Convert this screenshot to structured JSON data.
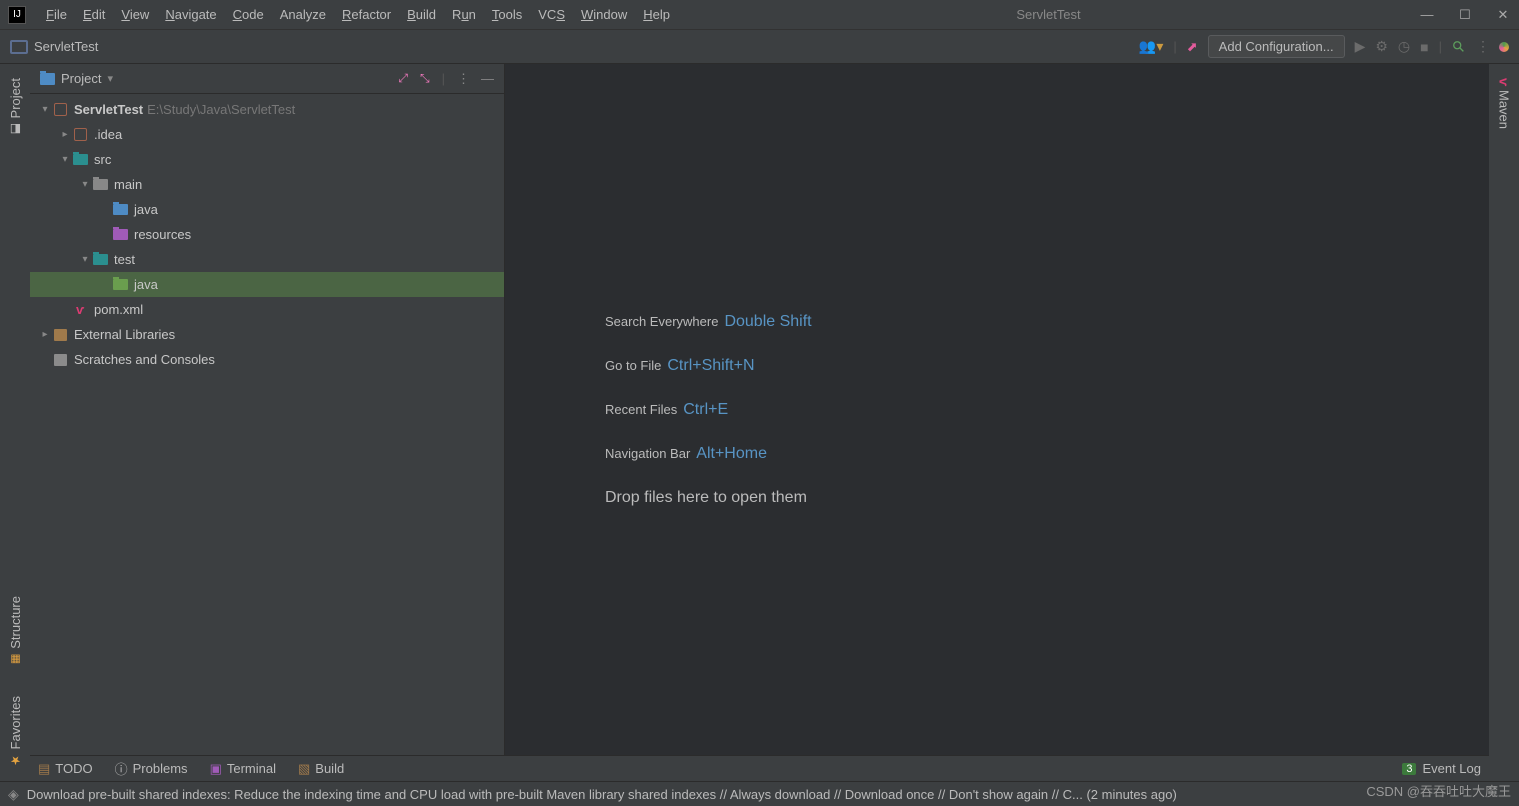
{
  "menubar": {
    "items": [
      "File",
      "Edit",
      "View",
      "Navigate",
      "Code",
      "Analyze",
      "Refactor",
      "Build",
      "Run",
      "Tools",
      "VCS",
      "Window",
      "Help"
    ],
    "project_title": "ServletTest"
  },
  "navbar": {
    "breadcrumb": "ServletTest",
    "add_config": "Add Configuration..."
  },
  "sidebar_left": {
    "project": "Project",
    "structure": "Structure",
    "favorites": "Favorites"
  },
  "sidebar_right": {
    "maven": "Maven"
  },
  "project_panel": {
    "title": "Project",
    "root": {
      "name": "ServletTest",
      "path": "E:\\Study\\Java\\ServletTest"
    },
    "tree": {
      "idea": ".idea",
      "src": "src",
      "main": "main",
      "java_main": "java",
      "resources": "resources",
      "test": "test",
      "java_test": "java",
      "pom": "pom.xml",
      "ext_lib": "External Libraries",
      "scratches": "Scratches and Consoles"
    }
  },
  "editor_hints": [
    {
      "label": "Search Everywhere",
      "key": "Double Shift"
    },
    {
      "label": "Go to File",
      "key": "Ctrl+Shift+N"
    },
    {
      "label": "Recent Files",
      "key": "Ctrl+E"
    },
    {
      "label": "Navigation Bar",
      "key": "Alt+Home"
    }
  ],
  "editor_drop": "Drop files here to open them",
  "bottom_tools": {
    "todo": "TODO",
    "problems": "Problems",
    "terminal": "Terminal",
    "build": "Build",
    "event_log": "Event Log",
    "event_count": "3"
  },
  "statusbar": {
    "message": "Download pre-built shared indexes: Reduce the indexing time and CPU load with pre-built Maven library shared indexes // Always download // Download once // Don't show again // C... (2 minutes ago)"
  },
  "watermark": "CSDN @吞吞吐吐大魔王"
}
